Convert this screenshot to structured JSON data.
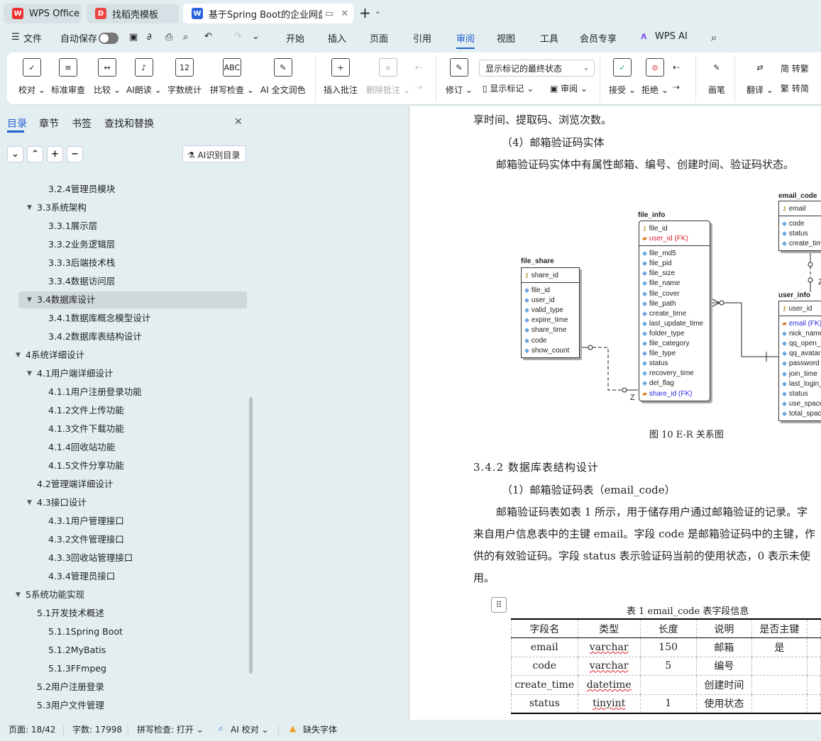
{
  "tabs": [
    {
      "label": "WPS Office",
      "icon": "wps-logo-icon"
    },
    {
      "label": "找稻壳模板",
      "icon": "docer-icon"
    },
    {
      "label": "基于Spring Boot的企业网盘",
      "icon": "writer-icon"
    }
  ],
  "quickbar": {
    "file": "文件",
    "autosave": "自动保存"
  },
  "menu": [
    "开始",
    "插入",
    "页面",
    "引用",
    "审阅",
    "视图",
    "工具",
    "会员专享",
    "WPS AI"
  ],
  "active_menu": "审阅",
  "ribbon": {
    "items": [
      {
        "label": "校对 ⌄",
        "glyph": "✓"
      },
      {
        "label": "标准审查",
        "glyph": "≡"
      },
      {
        "label": "比较 ⌄",
        "glyph": "↔"
      },
      {
        "label": "AI朗读 ⌄",
        "glyph": "♪"
      },
      {
        "label": "字数统计",
        "glyph": "12"
      },
      {
        "label": "拼写检查 ⌄",
        "glyph": "ABC"
      },
      {
        "label": "AI 全文润色",
        "glyph": "✎"
      },
      {
        "label": "插入批注",
        "glyph": "+"
      },
      {
        "label": "删除批注 ⌄",
        "glyph": "×"
      }
    ],
    "track_select": "显示标记的最终状态",
    "revise": "修订 ⌄",
    "show_marks": "显示标记 ⌄",
    "review": "审阅 ⌄",
    "accept": "接受 ⌄",
    "reject": "拒绝 ⌄",
    "pen": "画笔",
    "translate": "翻译 ⌄",
    "to_trad": "转繁",
    "to_simp": "转简"
  },
  "sidebar": {
    "tabs": [
      "目录",
      "章节",
      "书签",
      "查找和替换"
    ],
    "ai_toc": "AI识别目录",
    "toc": [
      {
        "t": "3.2.4管理员模块",
        "l": 3
      },
      {
        "t": "3.3系统架构",
        "l": 2,
        "a": 1
      },
      {
        "t": "3.3.1展示层",
        "l": 3
      },
      {
        "t": "3.3.2业务逻辑层",
        "l": 3
      },
      {
        "t": "3.3.3后端技术栈",
        "l": 3
      },
      {
        "t": "3.3.4数据访问层",
        "l": 3
      },
      {
        "t": "3.4数据库设计",
        "l": 2,
        "a": 1
      },
      {
        "t": "3.4.1数据库概念模型设计",
        "l": 3
      },
      {
        "t": "3.4.2数据库表结构设计",
        "l": 3
      },
      {
        "t": "4系统详细设计",
        "l": 1,
        "a": 1
      },
      {
        "t": "4.1用户端详细设计",
        "l": 2,
        "a": 1
      },
      {
        "t": "4.1.1用户注册登录功能",
        "l": 3
      },
      {
        "t": "4.1.2文件上传功能",
        "l": 3
      },
      {
        "t": "4.1.3文件下载功能",
        "l": 3
      },
      {
        "t": "4.1.4回收站功能",
        "l": 3
      },
      {
        "t": "4.1.5文件分享功能",
        "l": 3
      },
      {
        "t": "4.2管理端详细设计",
        "l": 2
      },
      {
        "t": "4.3接口设计",
        "l": 2,
        "a": 1
      },
      {
        "t": "4.3.1用户管理接口",
        "l": 3
      },
      {
        "t": "4.3.2文件管理接口",
        "l": 3
      },
      {
        "t": "4.3.3回收站管理接口",
        "l": 3
      },
      {
        "t": "4.3.4管理员接口",
        "l": 3
      },
      {
        "t": "5系统功能实现",
        "l": 1,
        "a": 1
      },
      {
        "t": "5.1开发技术概述",
        "l": 2
      },
      {
        "t": "5.1.1Spring Boot",
        "l": 3
      },
      {
        "t": "5.1.2MyBatis",
        "l": 3
      },
      {
        "t": "5.1.3FFmpeg",
        "l": 3
      },
      {
        "t": "5.2用户注册登录",
        "l": 2
      },
      {
        "t": "5.3用户文件管理",
        "l": 2
      }
    ],
    "selected": "3.4数据库设计"
  },
  "doc": {
    "l1": "享时间、提取码、浏览次数。",
    "l2": "（4）邮箱验证码实体",
    "l3": "邮箱验证码实体中有属性邮箱、编号、创建时间、验证码状态。",
    "caption": "图 10 E-R 关系图",
    "h": "3.4.2 数据库表结构设计",
    "sub": "（1）邮箱验证码表（email_code）",
    "p": [
      "邮箱验证码表如表 1 所示，用于储存用户通过邮箱验证的记录。字",
      "来自用户信息表中的主键 email。字段 code 是邮箱验证码中的主键，作",
      "供的有效验证码。字段 status 表示验证码当前的使用状态，0 表示未使",
      "用。"
    ],
    "table_caption": "表 1  email_code 表字段信息",
    "table": [
      [
        "字段名",
        "类型",
        "长度",
        "说明",
        "是否主键"
      ],
      [
        "email",
        "varchar",
        "150",
        "邮箱",
        "是"
      ],
      [
        "code",
        "varchar",
        "5",
        "编号",
        ""
      ],
      [
        "create_time",
        "datetime",
        "",
        "创建时间",
        ""
      ],
      [
        "status",
        "tinyint",
        "1",
        "使用状态",
        ""
      ]
    ]
  },
  "er": {
    "file_share": {
      "pk": [
        "share_id"
      ],
      "fields": [
        "file_id",
        "user_id",
        "valid_type",
        "expire_time",
        "share_time",
        "code",
        "show_count"
      ]
    },
    "file_info": {
      "pk": [
        "file_id"
      ],
      "fk": [
        "user_id (FK)"
      ],
      "fields": [
        "file_md5",
        "file_pid",
        "file_size",
        "file_name",
        "file_cover",
        "file_path",
        "create_time",
        "last_update_time",
        "folder_type",
        "file_category",
        "file_type",
        "status",
        "recovery_time",
        "del_flag"
      ],
      "fk2": [
        "share_id (FK)"
      ]
    },
    "email_code": {
      "pk": [
        "email"
      ],
      "fields": [
        "code",
        "status",
        "create_time"
      ]
    },
    "user_info": {
      "pk": [
        "user_id"
      ],
      "fk2": [
        "email (FK)"
      ],
      "fields": [
        "nick_name",
        "qq_open_id",
        "qq_avatar",
        "password",
        "join_time",
        "last_login_time",
        "status",
        "use_space",
        "total_space"
      ]
    },
    "z": "Z"
  },
  "status": {
    "page": "页面: 18/42",
    "words": "字数: 17998",
    "spell": "拼写检查: 打开 ⌄",
    "ai": "AI 校对 ⌄",
    "font": "缺失字体"
  }
}
